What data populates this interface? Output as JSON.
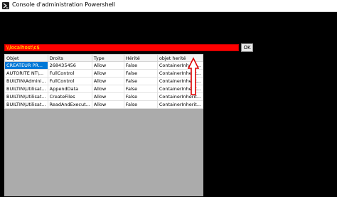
{
  "window": {
    "title": "Console d'administration Powershell"
  },
  "path_field": {
    "value": "\\\\localhost\\c$"
  },
  "ok_button": {
    "label": "OK"
  },
  "grid": {
    "columns": [
      "Objet",
      "Droits",
      "Type",
      "Hérité",
      "objet herité"
    ],
    "rows": [
      [
        "CREATEUR PR...",
        "268435456",
        "Allow",
        "False",
        "ContainerInherit..."
      ],
      [
        "AUTORITE NT\\...",
        "FullControl",
        "Allow",
        "False",
        "ContainerInherit..."
      ],
      [
        "BUILTIN\\Admini...",
        "FullControl",
        "Allow",
        "False",
        "ContainerInherit..."
      ],
      [
        "BUILTIN\\Utilisat...",
        "AppendData",
        "Allow",
        "False",
        "ContainerInherit..."
      ],
      [
        "BUILTIN\\Utilisat...",
        "CreateFiles",
        "Allow",
        "False",
        "ContainerInherit..."
      ],
      [
        "BUILTIN\\Utilisat...",
        "ReadAndExecut...",
        "Allow",
        "False",
        "ContainerInherit..."
      ]
    ]
  },
  "colors": {
    "accent": "#ff0000",
    "selection": "#0078d7",
    "field_text": "#ffff00"
  }
}
